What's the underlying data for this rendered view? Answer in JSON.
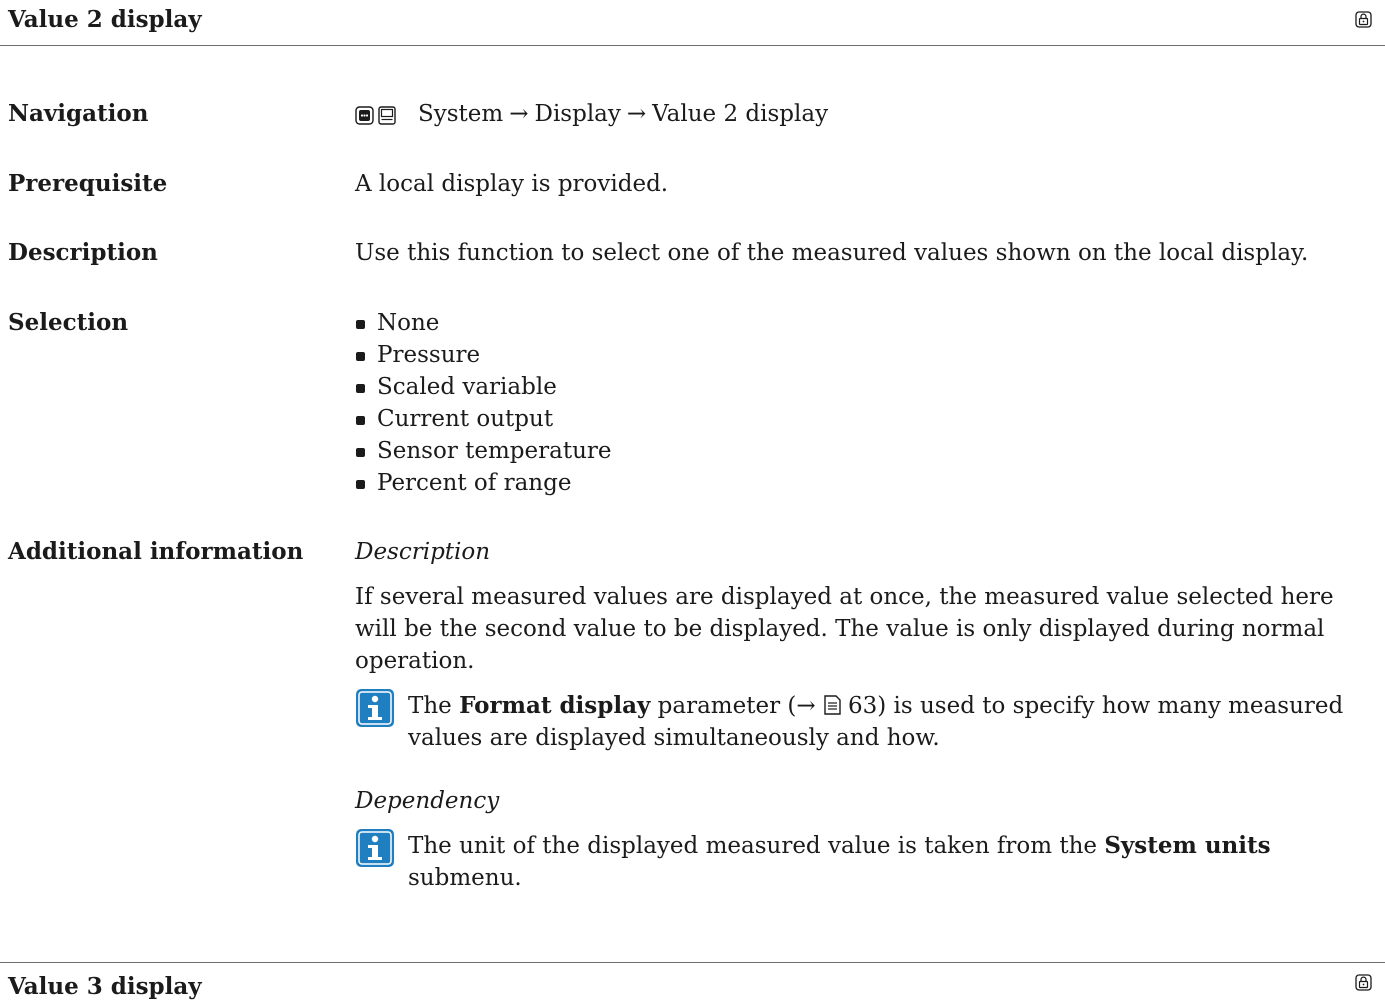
{
  "section1": {
    "title": "Value 2 display"
  },
  "navigation": {
    "label": "Navigation",
    "path": [
      "System",
      "Display",
      "Value 2 display"
    ],
    "separator": "→"
  },
  "prerequisite": {
    "label": "Prerequisite",
    "text": "A local display is provided."
  },
  "description": {
    "label": "Description",
    "text": "Use this function to select one of the measured values shown on the local display."
  },
  "selection": {
    "label": "Selection",
    "options": [
      "None",
      "Pressure",
      "Scaled variable",
      "Current output",
      "Sensor temperature",
      "Percent of range"
    ]
  },
  "additional_info": {
    "label": "Additional information",
    "description_heading": "Description",
    "description_text": "If several measured values are displayed at once, the measured value selected here will be the second value to be displayed. The value is only displayed during normal operation.",
    "note1": {
      "prefix": "The ",
      "bold": "Format display",
      "middle": " parameter (→ ",
      "page_ref": "63",
      "suffix": ") is used to specify how many measured values are displayed simultaneously and how."
    },
    "dependency_heading": "Dependency",
    "note2": {
      "prefix": "The unit of the displayed measured value is taken from the ",
      "bold": "System units",
      "suffix": " submenu."
    }
  },
  "section2": {
    "title": "Value 3 display"
  },
  "colors": {
    "text": "#1b1b1b",
    "info_icon_bg": "#1f7fc1",
    "rule": "#6e6e6e"
  },
  "icons": {
    "lock": "lock-icon",
    "info": "info-icon",
    "keypad": "keypad-icon",
    "display": "display-icon",
    "document": "document-icon"
  }
}
